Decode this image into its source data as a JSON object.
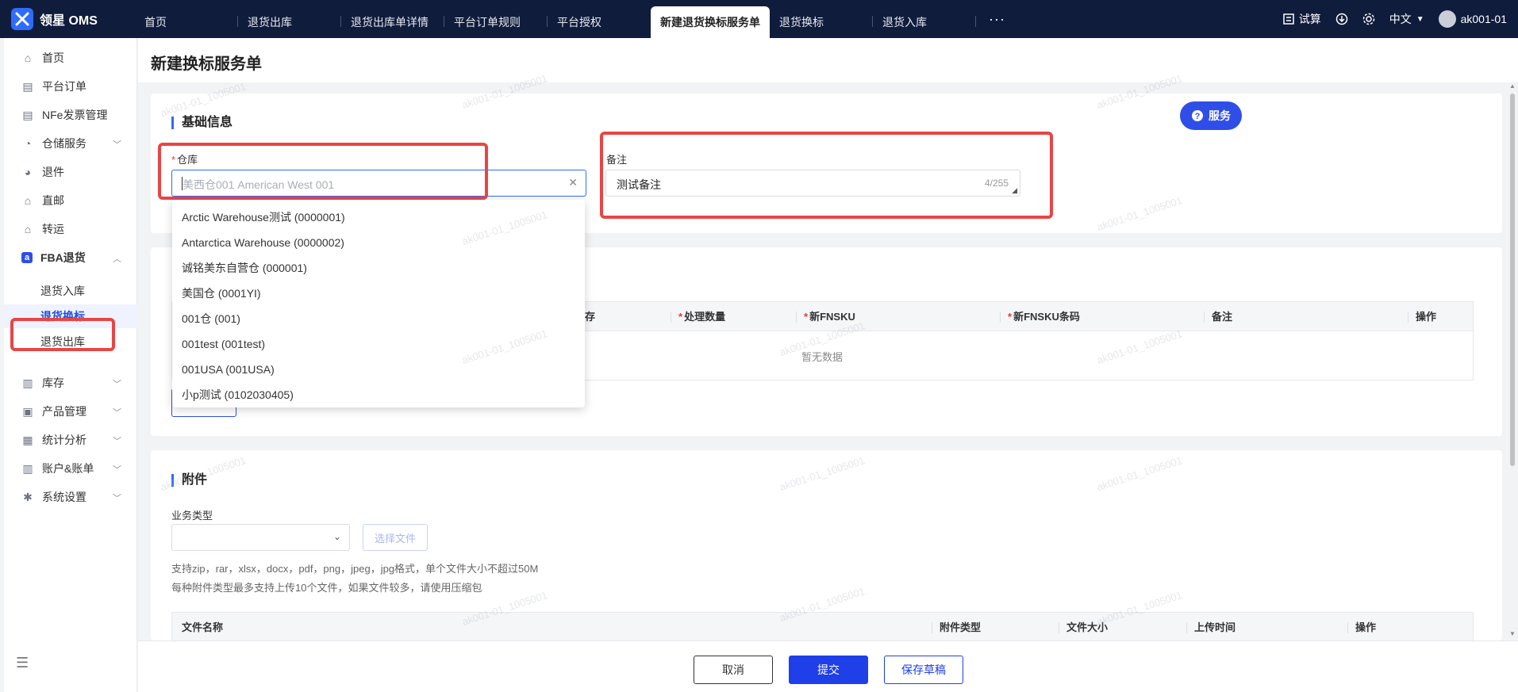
{
  "app": {
    "name": "领星 OMS"
  },
  "tabs": [
    {
      "label": "首页"
    },
    {
      "label": "退货出库"
    },
    {
      "label": "退货出库单详情"
    },
    {
      "label": "平台订单规则"
    },
    {
      "label": "平台授权"
    },
    {
      "label": "新建退货换标服务单",
      "active": true
    },
    {
      "label": "退货换标"
    },
    {
      "label": "退货入库"
    }
  ],
  "tab_more": "···",
  "topright": {
    "trial": "试算",
    "lang": "中文",
    "user": "ak001-01"
  },
  "sidebar": {
    "items": [
      {
        "label": "首页",
        "icon": "home-icon"
      },
      {
        "label": "平台订单",
        "icon": "order-icon"
      },
      {
        "label": "NFe发票管理",
        "icon": "invoice-icon"
      },
      {
        "label": "仓储服务",
        "icon": "warehouse-icon"
      },
      {
        "label": "退件",
        "icon": "return-icon"
      },
      {
        "label": "直邮",
        "icon": "mail-icon"
      },
      {
        "label": "转运",
        "icon": "transfer-icon"
      },
      {
        "label": "FBA退货",
        "icon": "amazon-icon"
      },
      {
        "label": "库存",
        "icon": "stock-icon"
      },
      {
        "label": "产品管理",
        "icon": "product-icon"
      },
      {
        "label": "统计分析",
        "icon": "chart-icon"
      },
      {
        "label": "账户&账单",
        "icon": "account-icon"
      },
      {
        "label": "系统设置",
        "icon": "settings-icon"
      }
    ],
    "sub_items": [
      {
        "label": "退货入库"
      },
      {
        "label": "退货换标",
        "active": true
      },
      {
        "label": "退货出库"
      }
    ]
  },
  "page": {
    "title": "新建换标服务单",
    "service_button": "服务"
  },
  "basic": {
    "title": "基础信息",
    "warehouse_label": "仓库",
    "warehouse_placeholder": "美西仓001 American West 001",
    "remark_label": "备注",
    "remark_value": "测试备注",
    "remark_count": "4/255"
  },
  "warehouse_options": [
    "Arctic Warehouse测试 (0000001)",
    "Antarctica Warehouse (0000002)",
    "诚铭美东自营仓 (000001)",
    "美国仓 (0001YI)",
    "001仓 (001)",
    "001test (001test)",
    "001USA (001USA)",
    "小p测试 (0102030405)"
  ],
  "items_table": {
    "columns": [
      "存",
      "处理数量",
      "新FNSKU",
      "新FNSKU条码",
      "备注",
      "操作"
    ],
    "empty_text": "暂无数据"
  },
  "attachments": {
    "title": "附件",
    "type_label": "业务类型",
    "choose_file": "选择文件",
    "hint1": "支持zip，rar，xlsx，docx，pdf，png，jpeg，jpg格式，单个文件大小不超过50M",
    "hint2": "每种附件类型最多支持上传10个文件，如果文件较多，请使用压缩包",
    "columns": [
      "文件名称",
      "附件类型",
      "文件大小",
      "上传时间",
      "操作"
    ]
  },
  "footer": {
    "cancel": "取消",
    "submit": "提交",
    "save_draft": "保存草稿"
  },
  "watermark": "ak001-01_1005001",
  "colors": {
    "topbar": "#101c3c",
    "primary": "#1f3fe8",
    "highlight": "#e84545"
  }
}
